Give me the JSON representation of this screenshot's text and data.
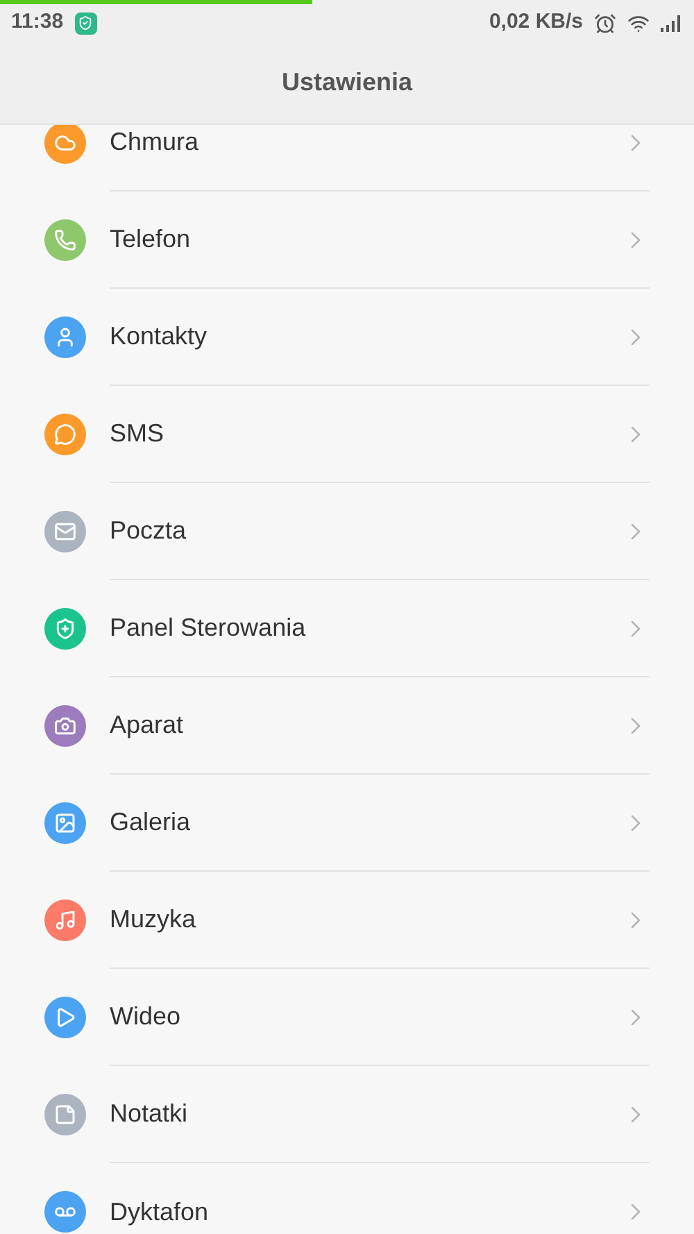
{
  "status_bar": {
    "time": "11:38",
    "speed": "0,02 KB/s",
    "progress": {
      "level": 0.45
    }
  },
  "header": {
    "title": "Ustawienia"
  },
  "items": [
    {
      "label": "Chmura",
      "color": "#fb9a2b"
    },
    {
      "label": "Telefon",
      "color": "#8fc86c"
    },
    {
      "label": "Kontakty",
      "color": "#4ba3f1"
    },
    {
      "label": "SMS",
      "color": "#fb9a2b"
    },
    {
      "label": "Poczta",
      "color": "#acb4c0"
    },
    {
      "label": "Panel Sterowania",
      "color": "#1bc38e"
    },
    {
      "label": "Aparat",
      "color": "#9c7cbc"
    },
    {
      "label": "Galeria",
      "color": "#4ba3f1"
    },
    {
      "label": "Muzyka",
      "color": "#fb7a68"
    },
    {
      "label": "Wideo",
      "color": "#4ba3f1"
    },
    {
      "label": "Notatki",
      "color": "#acb4c0"
    },
    {
      "label": "Dyktafon",
      "color": "#4ba3f1"
    }
  ]
}
